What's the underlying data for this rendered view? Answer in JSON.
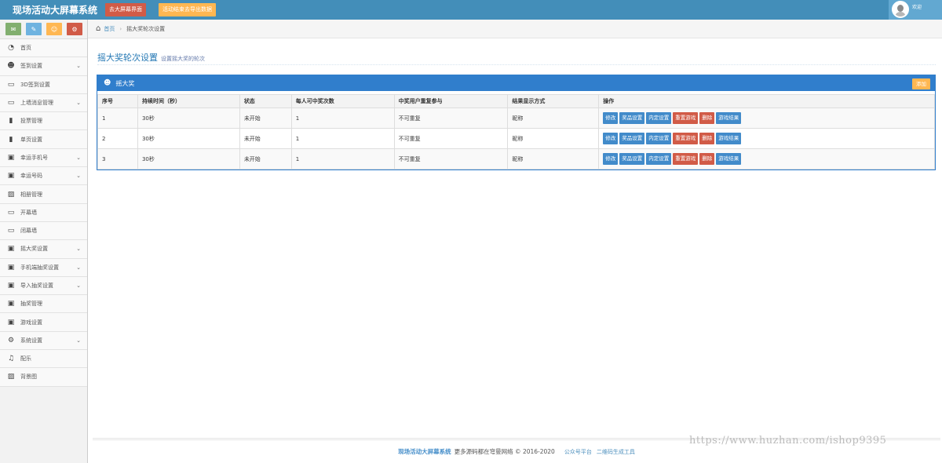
{
  "header": {
    "brand": "现场活动大屏幕系统",
    "btn_screen": "去大屏幕界面",
    "btn_export": "活动结束去导出数据",
    "welcome": "欢迎"
  },
  "shortcuts": [
    {
      "icon": "comment-icon",
      "glyph": "✉",
      "color": "#82af6f"
    },
    {
      "icon": "pencil-icon",
      "glyph": "✎",
      "color": "#6fb3e0"
    },
    {
      "icon": "users-icon",
      "glyph": "☺",
      "color": "#ffb752"
    },
    {
      "icon": "cogs-icon",
      "glyph": "⚙",
      "color": "#d15b47"
    }
  ],
  "sidebar": {
    "items": [
      {
        "label": "首页",
        "icon": "dashboard-icon",
        "glyph": "◔",
        "caret": false
      },
      {
        "label": "签到设置",
        "icon": "users-icon",
        "glyph": "☻",
        "caret": true
      },
      {
        "label": "3D签到设置",
        "icon": "desktop-icon",
        "glyph": "▭",
        "caret": false
      },
      {
        "label": "上墙消息管理",
        "icon": "desktop-icon",
        "glyph": "▭",
        "caret": true
      },
      {
        "label": "投票管理",
        "icon": "signal-icon",
        "glyph": "▮",
        "caret": false
      },
      {
        "label": "单页设置",
        "icon": "signal-icon",
        "glyph": "▮",
        "caret": false
      },
      {
        "label": "幸运手机号",
        "icon": "gift-icon",
        "glyph": "▣",
        "caret": true
      },
      {
        "label": "幸运号码",
        "icon": "gift-icon",
        "glyph": "▣",
        "caret": true
      },
      {
        "label": "相册管理",
        "icon": "picture-icon",
        "glyph": "▨",
        "caret": false
      },
      {
        "label": "开幕墙",
        "icon": "desktop-icon",
        "glyph": "▭",
        "caret": false
      },
      {
        "label": "闭幕墙",
        "icon": "desktop-icon",
        "glyph": "▭",
        "caret": false
      },
      {
        "label": "摇大奖设置",
        "icon": "gift-icon",
        "glyph": "▣",
        "caret": true
      },
      {
        "label": "手机端抽奖设置",
        "icon": "gift-icon",
        "glyph": "▣",
        "caret": true
      },
      {
        "label": "导入抽奖设置",
        "icon": "gift-icon",
        "glyph": "▣",
        "caret": true
      },
      {
        "label": "抽奖管理",
        "icon": "gift-icon",
        "glyph": "▣",
        "caret": false
      },
      {
        "label": "游戏设置",
        "icon": "gift-icon",
        "glyph": "▣",
        "caret": false
      },
      {
        "label": "系统设置",
        "icon": "gear-icon",
        "glyph": "⚙",
        "caret": true
      },
      {
        "label": "配乐",
        "icon": "music-icon",
        "glyph": "♫",
        "caret": false
      },
      {
        "label": "背景图",
        "icon": "picture-icon",
        "glyph": "▨",
        "caret": false
      }
    ]
  },
  "breadcrumb": {
    "home": "首页",
    "current": "摇大奖轮次设置"
  },
  "page": {
    "title": "摇大奖轮次设置",
    "subtitle": "设置摇大奖的轮次"
  },
  "widget": {
    "title": "摇大奖",
    "add_label": "添加"
  },
  "table": {
    "headers": [
      "序号",
      "持续时间（秒）",
      "状态",
      "每人可中奖次数",
      "中奖用户重复参与",
      "结果显示方式",
      "操作"
    ],
    "rows": [
      [
        "1",
        "30秒",
        "未开始",
        "1",
        "不可重复",
        "昵称"
      ],
      [
        "2",
        "30秒",
        "未开始",
        "1",
        "不可重复",
        "昵称"
      ],
      [
        "3",
        "30秒",
        "未开始",
        "1",
        "不可重复",
        "昵称"
      ]
    ],
    "actions": [
      {
        "label": "修改",
        "color": "#428bca"
      },
      {
        "label": "奖品设置",
        "color": "#428bca"
      },
      {
        "label": "内定设置",
        "color": "#428bca"
      },
      {
        "label": "重置游戏",
        "color": "#d15b47"
      },
      {
        "label": "删除",
        "color": "#d15b47"
      },
      {
        "label": "游戏结果",
        "color": "#428bca"
      }
    ]
  },
  "footer": {
    "brand": "现场活动大屏幕系统",
    "text": "更多源码都在穹曼网络 © 2016-2020",
    "link1": "公众号平台",
    "link2": "二维码生成工具"
  },
  "watermark": "https://www.huzhan.com/ishop9395"
}
